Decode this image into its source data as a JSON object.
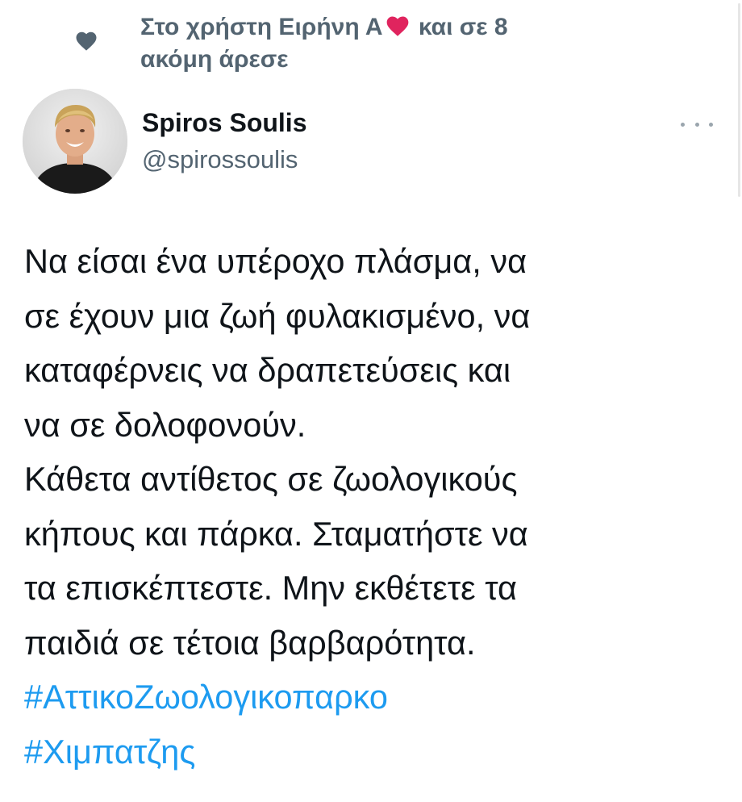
{
  "social_context": {
    "text_before_heart": "Στο χρήστη Ειρήνη Α",
    "text_after_heart": " και σε 8 ακόμη άρεσε",
    "heart_icon": "heart-icon",
    "inline_heart_emoji": "red-heart-emoji",
    "accent_color": "#536471",
    "emoji_color": "#e0245e"
  },
  "author": {
    "name": "Spiros Soulis",
    "handle": "@spirossoulis",
    "avatar_icon": "profile-photo",
    "more_icon": "more-options-icon"
  },
  "tweet": {
    "lines": [
      "Να είσαι ένα υπέροχο πλάσμα, να",
      "σε έχουν μια ζωή φυλακισμένο, να",
      "καταφέρνεις να δραπετεύσεις και",
      "να σε δολοφονούν.",
      "Κάθετα αντίθετος σε ζωολογικούς",
      "κήπους και πάρκα. Σταματήστε να",
      "τα επισκέπτεστε. Μην εκθέτετε τα",
      "παιδιά σε τέτοια βαρβαρότητα."
    ],
    "hashtags": [
      "#ΑττικοΖωολογικοπαρκο",
      "#Χιμπατζης"
    ],
    "hashtag_color": "#1d9bf0",
    "text_color": "#0f1419"
  }
}
